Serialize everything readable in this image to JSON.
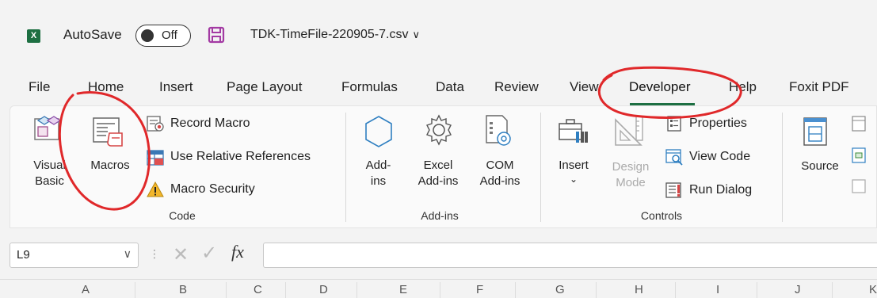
{
  "titlebar": {
    "app_logo": "X",
    "autosave_label": "AutoSave",
    "autosave_state": "Off",
    "save_icon": "floppy-disk-icon",
    "filename": "TDK-TimeFile-220905-7.csv",
    "filename_chevron": "∨"
  },
  "menu": {
    "tabs": [
      "File",
      "Home",
      "Insert",
      "Page Layout",
      "Formulas",
      "Data",
      "Review",
      "View",
      "Developer",
      "Help",
      "Foxit PDF"
    ],
    "active": "Developer",
    "accent_color": "#1d6f42"
  },
  "ribbon": {
    "code": {
      "visual_basic": [
        "Visual",
        "Basic"
      ],
      "macros": "Macros",
      "record_macro": "Record Macro",
      "relative_refs": "Use Relative References",
      "macro_security": "Macro Security",
      "group_label": "Code"
    },
    "addins": {
      "addins": [
        "Add-",
        "ins"
      ],
      "excel_addins": [
        "Excel",
        "Add-ins"
      ],
      "com_addins": [
        "COM",
        "Add-ins"
      ],
      "group_label": "Add-ins"
    },
    "controls": {
      "insert": "Insert",
      "insert_chevron": "⌄",
      "design_mode": [
        "Design",
        "Mode"
      ],
      "properties": "Properties",
      "view_code": "View Code",
      "run_dialog": "Run Dialog",
      "group_label": "Controls"
    },
    "xml": {
      "source": "Source"
    }
  },
  "formula_bar": {
    "name_box": "L9",
    "name_box_chevron": "∨",
    "dots": "⋮",
    "cancel": "✕",
    "enter": "✓",
    "fx": "fx",
    "value": ""
  },
  "columns": [
    "A",
    "B",
    "C",
    "D",
    "E",
    "F",
    "G",
    "H",
    "I",
    "J",
    "K"
  ],
  "annotation_color": "#e0282a"
}
